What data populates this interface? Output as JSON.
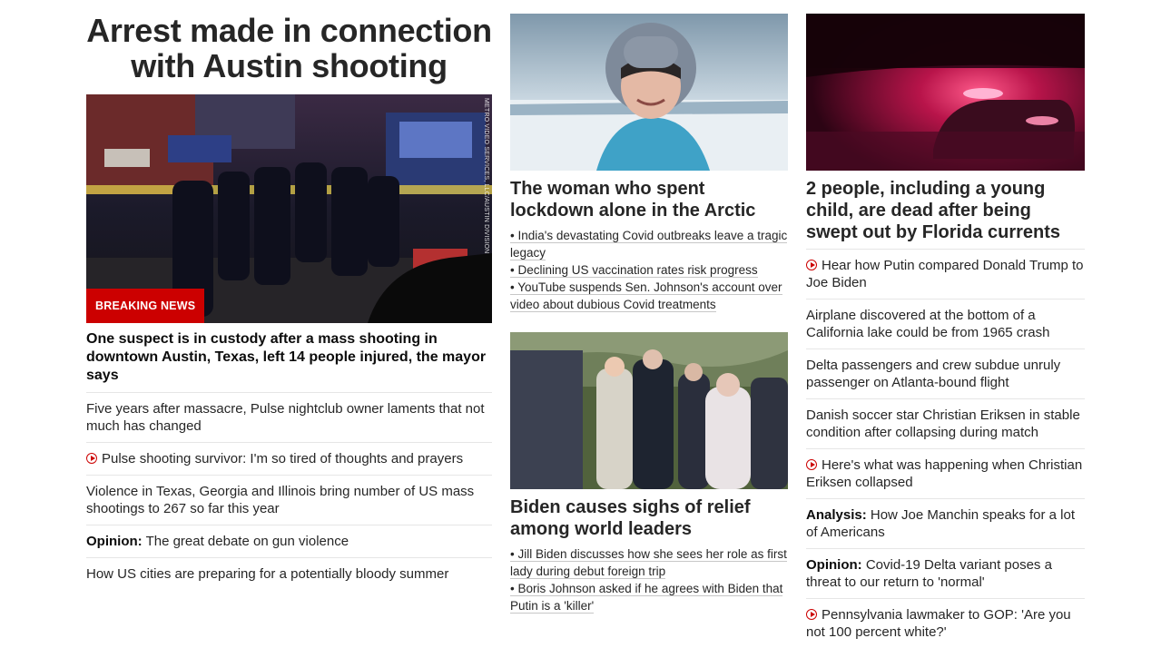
{
  "col1": {
    "headline": "Arrest made in connection with Austin shooting",
    "badge": "BREAKING NEWS",
    "photo_credit": "METRO VIDEO SERVICES, LLC/AUSTIN DIVISION",
    "lead": "One suspect is in custody after a mass shooting in downtown Austin, Texas, left 14 people injured, the mayor says",
    "stories": [
      {
        "label": "",
        "text": "Five years after massacre, Pulse nightclub owner laments that not much has changed",
        "video": false
      },
      {
        "label": "",
        "text": "Pulse shooting survivor: I'm so tired of thoughts and prayers",
        "video": true
      },
      {
        "label": "",
        "text": "Violence in Texas, Georgia and Illinois bring number of US mass shootings to 267 so far this year",
        "video": false
      },
      {
        "label": "Opinion:",
        "text": "The great debate on gun violence",
        "video": false
      },
      {
        "label": "",
        "text": "How US cities are preparing for a potentially bloody summer",
        "video": false
      }
    ]
  },
  "col2": {
    "story1": {
      "headline": "The woman who spent lockdown alone in the Arctic",
      "bullets": [
        "• India's devastating Covid outbreaks leave a tragic legacy",
        "• Declining US vaccination rates risk progress",
        "• YouTube suspends Sen. Johnson's account over video about dubious Covid treatments"
      ]
    },
    "story2": {
      "headline": "Biden causes sighs of relief among world leaders",
      "bullets": [
        "• Jill Biden discusses how she sees her role as first lady during debut foreign trip",
        "• Boris Johnson asked if he agrees with Biden that Putin is a 'killer'"
      ]
    }
  },
  "col3": {
    "headline": "2 people, including a young child, are dead after being swept out by Florida currents",
    "stories": [
      {
        "label": "",
        "text": "Hear how Putin compared Donald Trump to Joe Biden",
        "video": true
      },
      {
        "label": "",
        "text": "Airplane discovered at the bottom of a California lake could be from 1965 crash",
        "video": false
      },
      {
        "label": "",
        "text": "Delta passengers and crew subdue unruly passenger on Atlanta-bound flight",
        "video": false
      },
      {
        "label": "",
        "text": "Danish soccer star Christian Eriksen in stable condition after collapsing during match",
        "video": false
      },
      {
        "label": "",
        "text": "Here's what was happening when Christian Eriksen collapsed",
        "video": true
      },
      {
        "label": "Analysis:",
        "text": "How Joe Manchin speaks for a lot of Americans",
        "video": false
      },
      {
        "label": "Opinion:",
        "text": "Covid-19 Delta variant poses a threat to our return to 'normal'",
        "video": false
      },
      {
        "label": "",
        "text": "Pennsylvania lawmaker to GOP: 'Are you not 100 percent white?'",
        "video": true
      }
    ]
  },
  "colors": {
    "accent": "#cc0000",
    "text": "#262626",
    "divider": "#e6e6e6"
  }
}
